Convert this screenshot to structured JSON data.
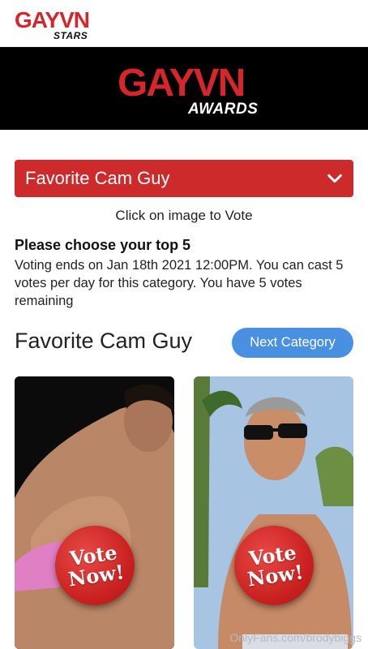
{
  "header": {
    "logo_word": "GAYVN",
    "logo_sub": "STARS"
  },
  "banner": {
    "logo_word": "GAYVN",
    "logo_sub": "AWARDS"
  },
  "category_select": {
    "selected": "Favorite Cam Guy"
  },
  "instruction": "Click on image to Vote",
  "voting": {
    "title": "Please choose your top 5",
    "info": "Voting ends on Jan 18th 2021 12:00PM. You can cast 5 votes per day for this category. You have 5 votes remaining"
  },
  "section": {
    "title": "Favorite Cam Guy",
    "next_button": "Next Category"
  },
  "nominees": [
    {
      "badge_line1": "Vote",
      "badge_line2": "Now!"
    },
    {
      "badge_line1": "Vote",
      "badge_line2": "Now!"
    }
  ],
  "watermark": "OnlyFans.com/brodybiggs",
  "colors": {
    "brand_red": "#cd2a2b",
    "button_blue": "#4a90e2"
  }
}
